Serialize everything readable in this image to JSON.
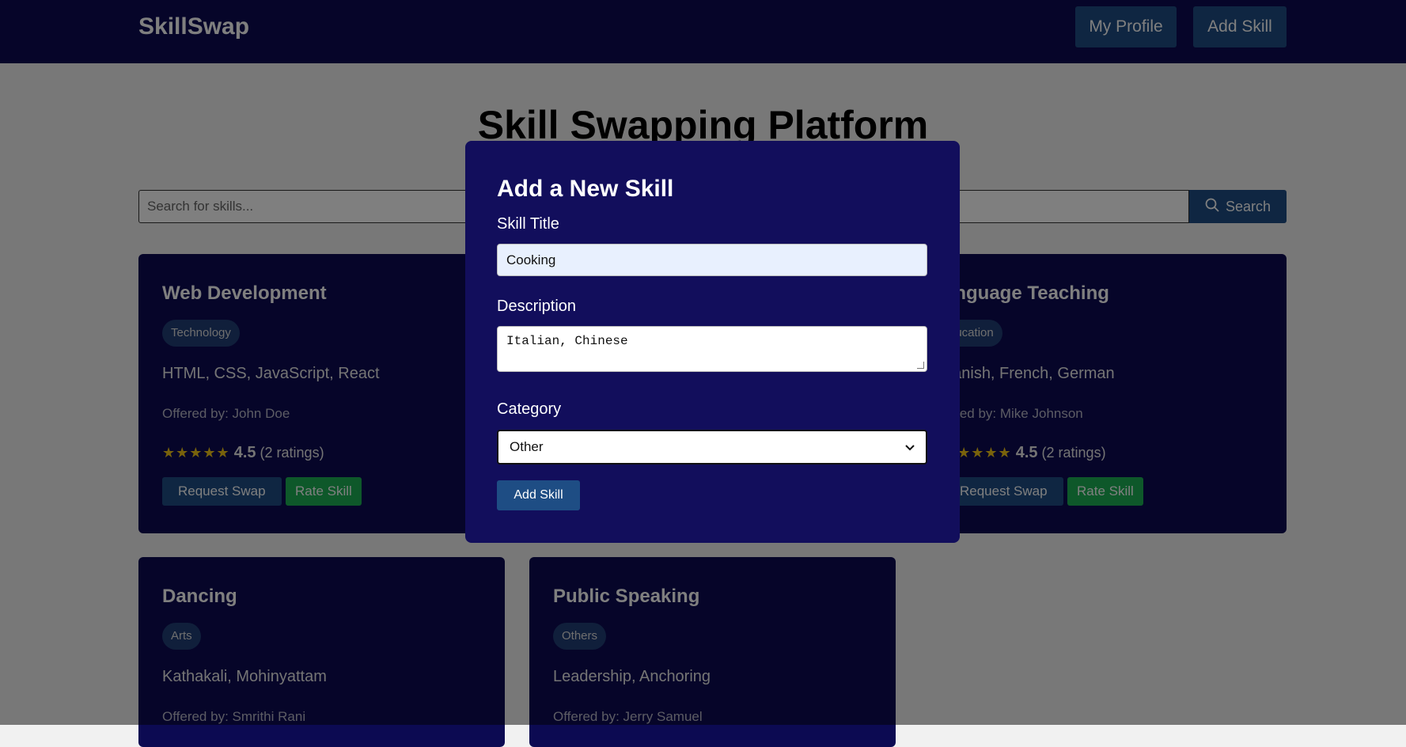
{
  "nav": {
    "logo": "SkillSwap",
    "my_profile": "My Profile",
    "add_skill": "Add Skill"
  },
  "page_title": "Skill Swapping Platform",
  "search": {
    "placeholder": "Search for skills...",
    "button_label": "Search"
  },
  "cards": [
    {
      "title": "Web Development",
      "tag": "Technology",
      "skills": "HTML, CSS, JavaScript, React",
      "offered_by": "Offered by: John Doe",
      "stars": "★★★★★",
      "rating": "4.5",
      "rating_count": "(2 ratings)",
      "request_label": "Request Swap",
      "rate_label": "Rate Skill"
    },
    {
      "title": "anguage Teaching",
      "tag": "ducation",
      "skills": "panish, French, German",
      "offered_by": "fered by: Mike Johnson",
      "stars": "★★★★★",
      "rating": "4.5",
      "rating_count": "(2 ratings)",
      "request_label": "Request Swap",
      "rate_label": "Rate Skill"
    },
    {
      "title": "Dancing",
      "tag": "Arts",
      "skills": "Kathakali, Mohinyattam",
      "offered_by": "Offered by: Smrithi Rani"
    },
    {
      "title": "Public Speaking",
      "tag": "Others",
      "skills": "Leadership, Anchoring",
      "offered_by": "Offered by: Jerry Samuel"
    }
  ],
  "modal": {
    "title": "Add a New Skill",
    "skill_title_label": "Skill Title",
    "skill_title_value": "Cooking",
    "description_label": "Description",
    "description_value": "Italian, Chinese",
    "category_label": "Category",
    "category_value": "Other",
    "submit_label": "Add Skill"
  },
  "colors": {
    "navbar": "#0c0a52",
    "card": "#0c0a52",
    "modal": "#120e5c",
    "primary_button": "#1e4d84",
    "rate_button": "#1db054",
    "star": "#f0c419"
  },
  "icons": {
    "search": "search-icon",
    "select_chevron": "chevron-down-icon"
  }
}
